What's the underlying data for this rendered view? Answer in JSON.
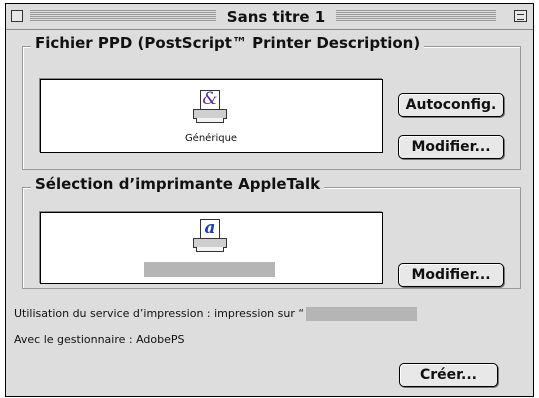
{
  "window": {
    "title": "Sans titre 1"
  },
  "ppd_group": {
    "legend": "Fichier PPD (PostScript™ Printer Description)",
    "selected_ppd_label": "Générique",
    "autoconfig_button": "Autoconfig.",
    "modify_button": "Modifier..."
  },
  "appletalk_group": {
    "legend": "Sélection d’imprimante AppleTalk",
    "modify_button": "Modifier..."
  },
  "status": {
    "service_prefix": "Utilisation du service d’impression : impression sur “",
    "service_suffix": " ”",
    "manager_line": "Avec le gestionnaire : AdobePS"
  },
  "actions": {
    "create_button": "Créer..."
  },
  "icons": {
    "ppd_printer": "ampersand-printer-icon",
    "appletalk_printer": "appletalk-printer-icon"
  },
  "colors": {
    "window_bg": "#dddddd",
    "ppd_glyph": "#5a2aa0",
    "appletalk_glyph": "#1a3db0"
  }
}
